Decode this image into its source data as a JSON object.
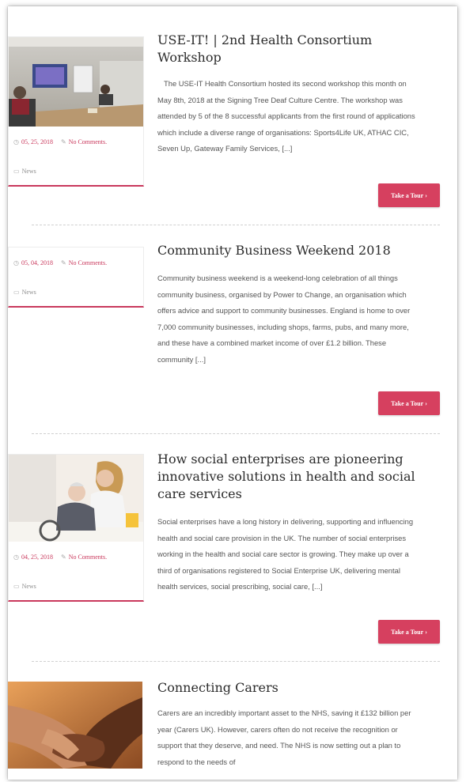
{
  "posts": [
    {
      "title": "USE-IT! | 2nd Health Consortium Workshop",
      "excerpt": "The USE-IT Health Consortium hosted its second workshop this month on May 8th, 2018 at the Signing Tree Deaf Culture Centre. The workshop was attended by 5 of the 8 successful applicants from the first round of applications which include a diverse range of organisations: Sports4Life UK, ATHAC CIC, Seven Up, Gateway Family Services, [...]",
      "date": "05, 25, 2018",
      "comments": "No Comments.",
      "category": "News",
      "button": "Take a Tour",
      "image": "workshop-room-photo"
    },
    {
      "title": "Community Business Weekend 2018",
      "excerpt": "Community business weekend is a weekend-long celebration of all things community business, organised by Power to Change, an organisation which offers advice and support to community businesses. England is home to over 7,000 community businesses, including shops, farms, pubs, and many more, and these have a combined market income of over £1.2 billion. These community [...]",
      "date": "05, 04, 2018",
      "comments": "No Comments.",
      "category": "News",
      "button": "Take a Tour"
    },
    {
      "title": "How social enterprises are pioneering innovative solutions in health and social care services",
      "excerpt": "Social enterprises have a long history in delivering, supporting and influencing health and social care provision in the UK. The number of social enterprises working in the health and social care sector is growing. They make up over a third of organisations registered to Social Enterprise UK, delivering mental health services, social prescribing, social care, [...]",
      "date": "04, 25, 2018",
      "comments": "No Comments.",
      "category": "News",
      "button": "Take a Tour",
      "image": "carer-and-elderly-man-photo"
    },
    {
      "title": "Connecting Carers",
      "excerpt": "Carers are an incredibly important asset to the NHS, saving it £132 billion per year (Carers UK). However, carers often do not receive the recognition or support that they deserve, and need. The NHS is now setting out a plan to respond to the needs of",
      "image": "holding-hands-photo"
    }
  ],
  "colors": {
    "accent": "#d6405f",
    "meta": "#c9385c"
  }
}
